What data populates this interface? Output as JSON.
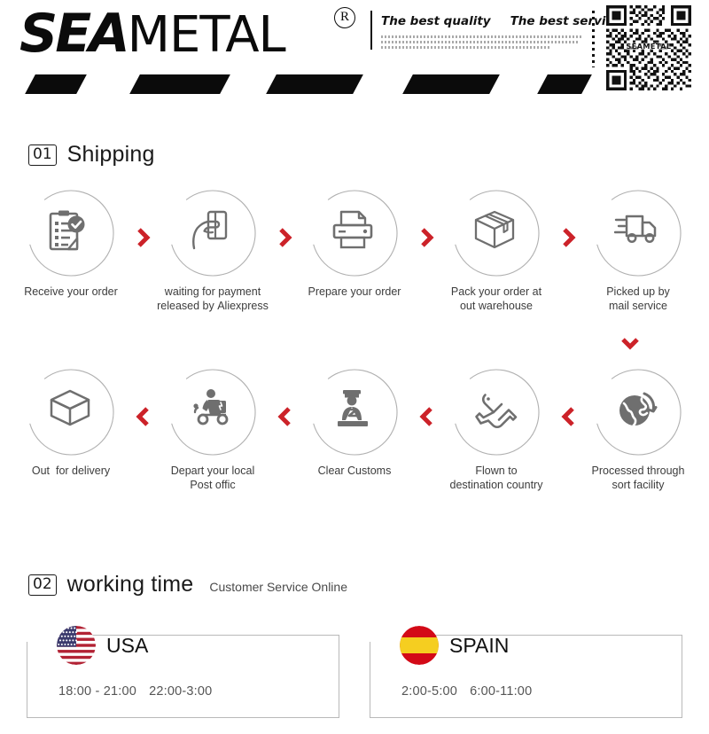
{
  "brand": {
    "logo_sea": "SEA",
    "logo_metal": "METAL",
    "registered_mark": "R",
    "slogan_left": "The best quality",
    "slogan_right": "The best service",
    "qr_label": "SEAMETAL",
    "qr_icon": "qr-code-icon"
  },
  "sections": {
    "shipping": {
      "number": "01",
      "title": "Shipping"
    },
    "working_time": {
      "number": "02",
      "title": "working time",
      "subtitle": "Customer Service Online"
    }
  },
  "shipping_steps_row1": [
    {
      "label": "Receive your order",
      "icon": "clipboard-check-icon"
    },
    {
      "label": "waiting for payment\nreleased by Aliexpress",
      "icon": "hand-card-icon"
    },
    {
      "label": "Prepare your order",
      "icon": "printer-icon"
    },
    {
      "label": "Pack your order at\nout warehouse",
      "icon": "box-icon"
    },
    {
      "label": "Picked up by\nmail service",
      "icon": "truck-icon"
    }
  ],
  "shipping_steps_row2": [
    {
      "label": "Out  for delivery",
      "icon": "open-box-icon"
    },
    {
      "label": "Depart your local\nPost offic",
      "icon": "scooter-courier-icon"
    },
    {
      "label": "Clear Customs",
      "icon": "customs-officer-icon"
    },
    {
      "label": "Flown to\ndestination country",
      "icon": "airplane-icon"
    },
    {
      "label": "Processed through\nsort facility",
      "icon": "globe-arrow-icon"
    }
  ],
  "arrows": {
    "row1_direction": "chevron-right-icon",
    "row2_direction": "chevron-left-icon",
    "connector": "chevron-down-icon"
  },
  "working_time_cards": [
    {
      "country": "USA",
      "flag": "flag-usa-icon",
      "hours": [
        "18:00 - 21:00",
        "22:00-3:00"
      ]
    },
    {
      "country": "SPAIN",
      "flag": "flag-spain-icon",
      "hours": [
        "2:00-5:00",
        "6:00-11:00"
      ]
    }
  ],
  "colors": {
    "accent_red": "#CC2229",
    "ink": "#1a1a1a",
    "text_gray": "#3c3c3c",
    "line_gray": "#b9b9b9",
    "icon_gray": "#6f6f6f"
  }
}
